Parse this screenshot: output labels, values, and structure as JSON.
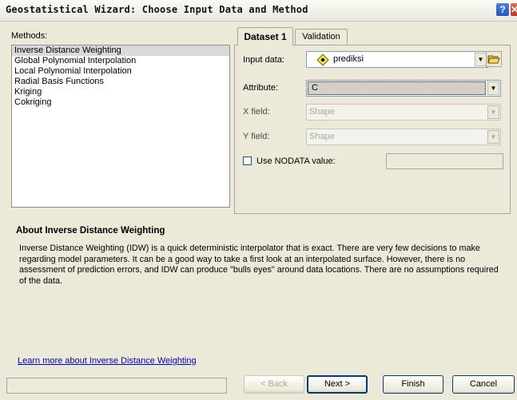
{
  "window": {
    "title": "Geostatistical Wizard: Choose Input Data and Method"
  },
  "methods": {
    "label": "Methods:",
    "items": [
      "Inverse Distance Weighting",
      "Global Polynomial Interpolation",
      "Local Polynomial Interpolation",
      "Radial Basis Functions",
      "Kriging",
      "Cokriging"
    ],
    "selected_index": 0
  },
  "tabs": [
    "Dataset 1",
    "Validation"
  ],
  "form": {
    "input_data_label": "Input data:",
    "input_data_value": "prediksi",
    "attribute_label": "Attribute:",
    "attribute_value": "C",
    "x_field_label": "X field:",
    "x_field_value": "Shape",
    "y_field_label": "Y field:",
    "y_field_value": "Shape",
    "nodata_label": "Use NODATA value:",
    "nodata_checked": false,
    "nodata_value": ""
  },
  "about": {
    "title": "About Inverse Distance Weighting",
    "text": "Inverse Distance Weighting (IDW) is a quick deterministic interpolator that is exact. There are very few decisions to make regarding model parameters. It can be a good way to take a first look at an interpolated surface. However, there is no assessment of prediction errors, and IDW can produce \"bulls eyes\" around data locations. There are no assumptions required of the data.",
    "link": "Learn more about Inverse Distance Weighting"
  },
  "buttons": {
    "back": "< Back",
    "next": "Next >",
    "finish": "Finish",
    "cancel": "Cancel"
  },
  "icons": {
    "help": "help-icon",
    "close": "close-icon",
    "layer": "point-layer-icon",
    "folder": "open-folder-icon"
  },
  "colors": {
    "selection": "#d9d9d9",
    "link": "#0000cc",
    "window": "#ece9d8"
  }
}
